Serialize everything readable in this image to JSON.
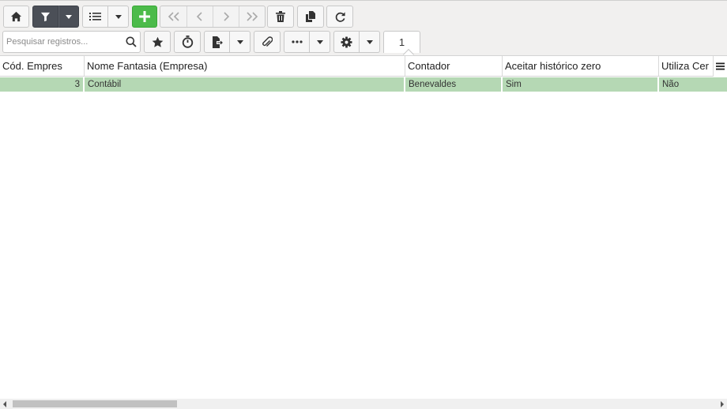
{
  "colors": {
    "toolbar_bg": "#f1f0ef",
    "filter_button": "#4b4f57",
    "add_button": "#4cbb4a",
    "selected_row": "#b5d8b4"
  },
  "toolbar": {
    "icons": [
      "home-icon",
      "filter-icon",
      "list-icon",
      "plus-icon",
      "first-page-icon",
      "previous-icon",
      "next-icon",
      "last-page-icon",
      "trash-icon",
      "copy-icon",
      "refresh-icon",
      "star-icon",
      "stopwatch-icon",
      "export-icon",
      "paperclip-icon",
      "ellipsis-icon",
      "gear-icon"
    ],
    "search_placeholder": "Pesquisar registros...",
    "page_number": "1"
  },
  "grid": {
    "columns": [
      "Cód. Empres",
      "Nome Fantasia (Empresa)",
      "Contador",
      "Aceitar histórico zero",
      "Utiliza Cer"
    ],
    "rows": [
      {
        "codigo": "3",
        "nome": "Contábil",
        "contador": "Benevaldes",
        "aceitar": "Sim",
        "utiliza": "Não"
      }
    ]
  }
}
